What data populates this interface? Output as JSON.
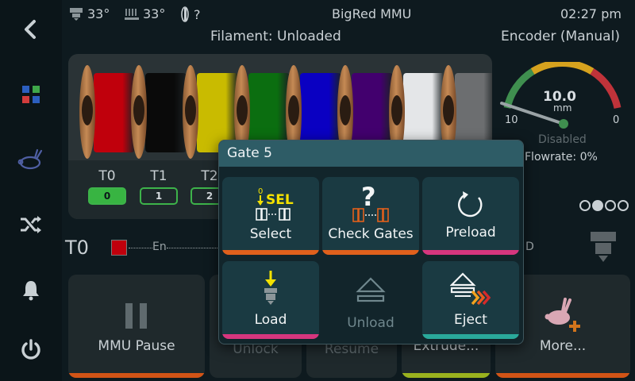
{
  "status": {
    "extruder_temp": "33°",
    "bed_temp": "33°",
    "fan_value": "?",
    "title": "BigRed MMU",
    "time": "02:27 pm"
  },
  "filament_status": "Filament: Unloaded",
  "encoder_label": "Encoder (Manual)",
  "gauge": {
    "value": "10.0",
    "unit": "mm",
    "min": "10",
    "max": "0",
    "state": "Disabled",
    "flowrate": "Flowrate: 0%"
  },
  "spools": [
    {
      "color": "#c0000c"
    },
    {
      "color": "#0a0a0a"
    },
    {
      "color": "#c9bb00"
    },
    {
      "color": "#0b6e10"
    },
    {
      "color": "#0a00c2"
    },
    {
      "color": "#42006e"
    },
    {
      "color": "#e4e6e8"
    },
    {
      "color": "#6c6e70"
    }
  ],
  "gates": [
    {
      "label": "T0",
      "badge": "0"
    },
    {
      "label": "T1",
      "badge": "1"
    },
    {
      "label": "T2",
      "badge": "2"
    }
  ],
  "tool_line": {
    "tool": "T0",
    "en_label": "En",
    "d_label": "D"
  },
  "bottom_buttons": [
    {
      "label": "MMU Pause"
    },
    {
      "label": "Unlock"
    },
    {
      "label": "Resume"
    },
    {
      "label": "Extrude..."
    },
    {
      "label": "More..."
    }
  ],
  "modal": {
    "title": "Gate 5",
    "select_label": "Select",
    "select_icon_text": "SEL",
    "select_icon_num": "0",
    "check_gates_label": "Check Gates",
    "preload_label": "Preload",
    "load_label": "Load",
    "unload_label": "Unload",
    "eject_label": "Eject"
  },
  "colors": {
    "accent_orange": "#e0601c",
    "accent_pink": "#d6367e",
    "accent_teal": "#2aa99b",
    "accent_lime": "#9ab21e",
    "gate_green": "#3db34a"
  }
}
